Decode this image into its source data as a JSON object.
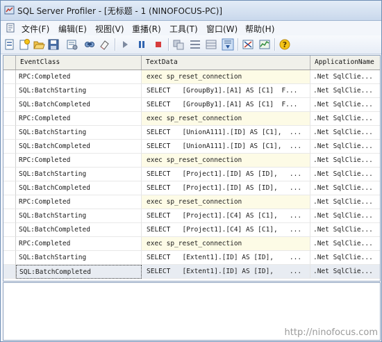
{
  "window": {
    "title": "SQL Server Profiler - [无标题 - 1 (NINOFOCUS-PC)]"
  },
  "menu": {
    "items": [
      "文件(F)",
      "编辑(E)",
      "视图(V)",
      "重播(R)",
      "工具(T)",
      "窗口(W)",
      "帮助(H)"
    ]
  },
  "toolbar": {
    "icons": [
      "new-trace-icon",
      "new-template-icon",
      "open-icon",
      "save-icon",
      "properties-icon",
      "find-icon",
      "clear-icon",
      "run-icon",
      "pause-icon",
      "stop-icon",
      "step-icon",
      "breakpoint-icon",
      "watch-icon",
      "autoscroll-icon",
      "profiler-icon",
      "perfmon-icon",
      "help-icon"
    ]
  },
  "grid": {
    "columns": [
      "EventClass",
      "TextData",
      "ApplicationName"
    ],
    "rows": [
      {
        "event": "RPC:Completed",
        "text": "exec sp_reset_connection",
        "app": ".Net SqlClie..."
      },
      {
        "event": "SQL:BatchStarting",
        "text": "SELECT   [GroupBy1].[A1] AS [C1]  F...",
        "app": ".Net SqlClie..."
      },
      {
        "event": "SQL:BatchCompleted",
        "text": "SELECT   [GroupBy1].[A1] AS [C1]  F...",
        "app": ".Net SqlClie..."
      },
      {
        "event": "RPC:Completed",
        "text": "exec sp_reset_connection",
        "app": ".Net SqlClie..."
      },
      {
        "event": "SQL:BatchStarting",
        "text": "SELECT   [UnionA111].[ID] AS [C1],  ...",
        "app": ".Net SqlClie..."
      },
      {
        "event": "SQL:BatchCompleted",
        "text": "SELECT   [UnionA111].[ID] AS [C1],  ...",
        "app": ".Net SqlClie..."
      },
      {
        "event": "RPC:Completed",
        "text": "exec sp_reset_connection",
        "app": ".Net SqlClie..."
      },
      {
        "event": "SQL:BatchStarting",
        "text": "SELECT   [Project1].[ID] AS [ID],   ...",
        "app": ".Net SqlClie..."
      },
      {
        "event": "SQL:BatchCompleted",
        "text": "SELECT   [Project1].[ID] AS [ID],   ...",
        "app": ".Net SqlClie..."
      },
      {
        "event": "RPC:Completed",
        "text": "exec sp_reset_connection",
        "app": ".Net SqlClie..."
      },
      {
        "event": "SQL:BatchStarting",
        "text": "SELECT   [Project1].[C4] AS [C1],   ...",
        "app": ".Net SqlClie..."
      },
      {
        "event": "SQL:BatchCompleted",
        "text": "SELECT   [Project1].[C4] AS [C1],   ...",
        "app": ".Net SqlClie..."
      },
      {
        "event": "RPC:Completed",
        "text": "exec sp_reset_connection",
        "app": ".Net SqlClie..."
      },
      {
        "event": "SQL:BatchStarting",
        "text": "SELECT   [Extent1].[ID] AS [ID],    ...",
        "app": ".Net SqlClie..."
      },
      {
        "event": "SQL:BatchCompleted",
        "text": "SELECT   [Extent1].[ID] AS [ID],    ...",
        "app": ".Net SqlClie..."
      }
    ],
    "selected_index": 14
  },
  "watermark": "http://ninofocus.com"
}
